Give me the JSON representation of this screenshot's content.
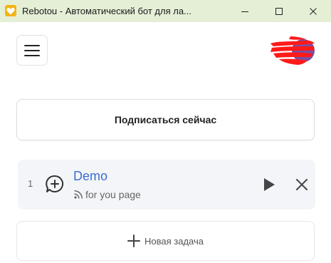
{
  "window": {
    "title": "Rebotou - Автоматический бот для ла...",
    "icon": "heart-icon"
  },
  "header": {
    "menu_icon": "hamburger-icon",
    "avatar": "user-avatar (redacted)"
  },
  "subscribe": {
    "label": "Подписаться сейчас"
  },
  "tasks": [
    {
      "index": "1",
      "name": "Demo",
      "type": "for you page",
      "type_icon": "rss-icon",
      "icon": "add-comment-icon"
    }
  ],
  "new_task": {
    "label": "Новая задача",
    "icon": "plus-icon"
  },
  "colors": {
    "titlebar_bg": "#e5efd6",
    "task_name": "#3b6fd1",
    "task_card_bg": "#f3f5f8"
  }
}
